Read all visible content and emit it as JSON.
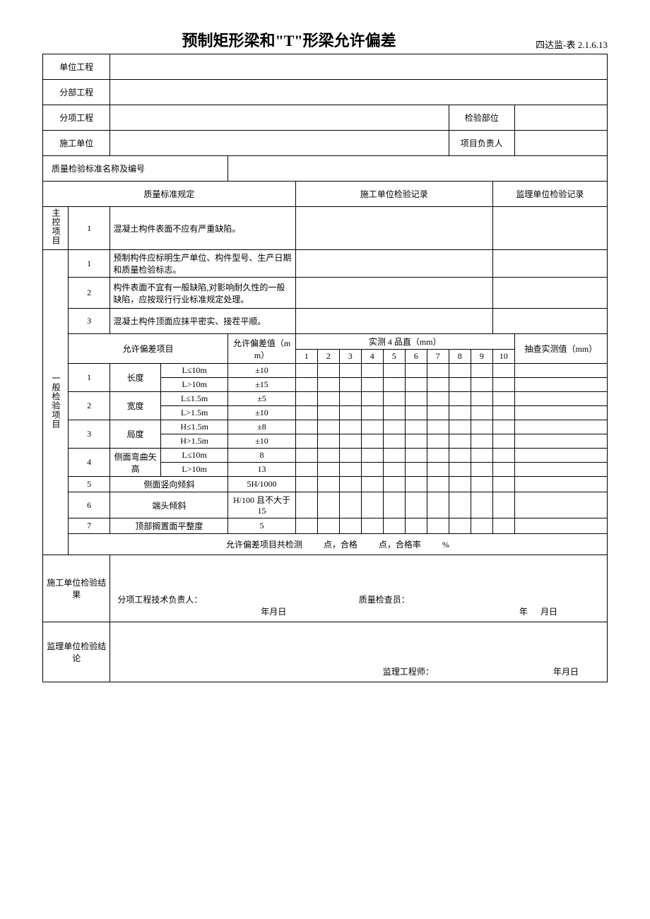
{
  "header": {
    "title": "预制矩形梁和\"T\"形梁允许偏差",
    "doc_code": "四达监-表 2.1.6.13"
  },
  "fields": {
    "unit_project": "单位工程",
    "sub_project": "分部工程",
    "item_project": "分项工程",
    "inspect_part": "检验部位",
    "construction_unit": "施工单位",
    "project_leader": "项目负责人",
    "quality_std_name_no": "质量检验标准名称及编号"
  },
  "sections": {
    "quality_std": "质量标准规定",
    "construction_record": "施工单位检验记录",
    "supervision_record": "监理单位检验记录",
    "main_control": "主控项目",
    "general": "一般检验项目"
  },
  "main_items": {
    "r1": {
      "no": "1",
      "text": "混凝土构件表面不应有严重缺陷。"
    }
  },
  "general_items": {
    "r1": {
      "no": "1",
      "text": "预制构件应标明生产单位、构件型号、生产日期和质量检验标志。"
    },
    "r2": {
      "no": "2",
      "text": "构件表面不宜有一般缺陷,对影响耐久性的一般缺陷，应按现行行业标准规定处理。"
    },
    "r3": {
      "no": "3",
      "text": "混凝土构件顶面应抹平密实、接茬平顺。"
    }
  },
  "deviation_header": {
    "item": "允许偏差项目",
    "value": "允许偏差值（mm）",
    "measured": "实测 4   品直（mm）",
    "cols": {
      "c1": "1",
      "c2": "2",
      "c3": "3",
      "c4": "4",
      "c5": "5",
      "c6": "6",
      "c7": "7",
      "c8": "8",
      "c9": "9",
      "c10": "10"
    },
    "spot_check": "抽查实测值（mm）"
  },
  "deviations": {
    "r1": {
      "no": "1",
      "name": "长度",
      "cond1": "L≤10m",
      "val1": "±10",
      "cond2": "L>10m",
      "val2": "±15"
    },
    "r2": {
      "no": "2",
      "name": "宽度",
      "cond1": "L≤1.5m",
      "val1": "±5",
      "cond2": "L>1.5m",
      "val2": "±10"
    },
    "r3": {
      "no": "3",
      "name": "局度",
      "cond1": "H≤1.5m",
      "val1": "±8",
      "cond2": "H>1.5m",
      "val2": "±10"
    },
    "r4": {
      "no": "4",
      "name": "侧面弯曲矢高",
      "cond1": "L≤10m",
      "val1": "8",
      "cond2": "L>10m",
      "val2": "13"
    },
    "r5": {
      "no": "5",
      "name": "侧面竖向倾斜",
      "val": "5H/1000"
    },
    "r6": {
      "no": "6",
      "name": "端头倾斜",
      "val": "H/100 且不大于 15"
    },
    "r7": {
      "no": "7",
      "name": "顶部搁置面平整度",
      "val": "5"
    }
  },
  "summary": {
    "prefix": "允许偏差项目共检测",
    "points": "点，合格",
    "points2": "点，合格率",
    "pct": "%"
  },
  "signatures": {
    "construction_result": "施工单位检验结果",
    "tech_leader": "分项工程技术负责人：",
    "quality_inspector": "质量检查员：",
    "date1": "年月日",
    "date2_y": "年",
    "date2_md": "月日",
    "supervision_conclusion": "监理单位检验结论",
    "supervisor": "监理工程师：",
    "date3": "年月日"
  }
}
